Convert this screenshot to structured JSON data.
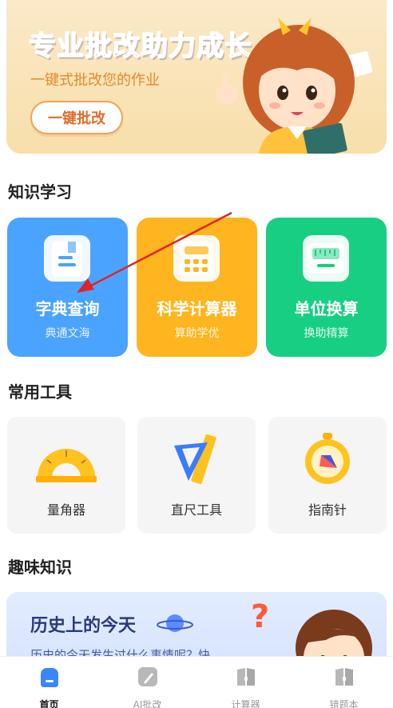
{
  "banner": {
    "title_part1": "专业批改",
    "title_part2": "助力成长",
    "subtitle": "一键式批改您的作业",
    "button_label": "一键批改"
  },
  "knowledge": {
    "heading": "知识学习",
    "cards": [
      {
        "title": "字典查询",
        "subtitle": "典通文海",
        "color": "#4aa3ff"
      },
      {
        "title": "科学计算器",
        "subtitle": "算助学优",
        "color": "#ffb51f"
      },
      {
        "title": "单位换算",
        "subtitle": "换助精算",
        "color": "#17cf83"
      }
    ]
  },
  "tools": {
    "heading": "常用工具",
    "items": [
      {
        "label": "量角器",
        "icon": "protractor-icon"
      },
      {
        "label": "直尺工具",
        "icon": "ruler-icon"
      },
      {
        "label": "指南针",
        "icon": "compass-icon"
      }
    ]
  },
  "fun": {
    "heading": "趣味知识",
    "card_title": "历史上的今天",
    "card_subtitle": "历史的今天发生过什么事情呢？快"
  },
  "tabbar": {
    "items": [
      {
        "label": "首页",
        "icon": "home-icon",
        "active": true
      },
      {
        "label": "AI批改",
        "icon": "ai-correct-icon",
        "active": false
      },
      {
        "label": "计算器",
        "icon": "calculator-icon",
        "active": false
      },
      {
        "label": "错题本",
        "icon": "mistake-book-icon",
        "active": false
      }
    ]
  },
  "colors": {
    "accent_blue": "#4aa3ff",
    "accent_yellow": "#ffb51f",
    "accent_green": "#17cf83",
    "banner_title": "#243b8f"
  }
}
